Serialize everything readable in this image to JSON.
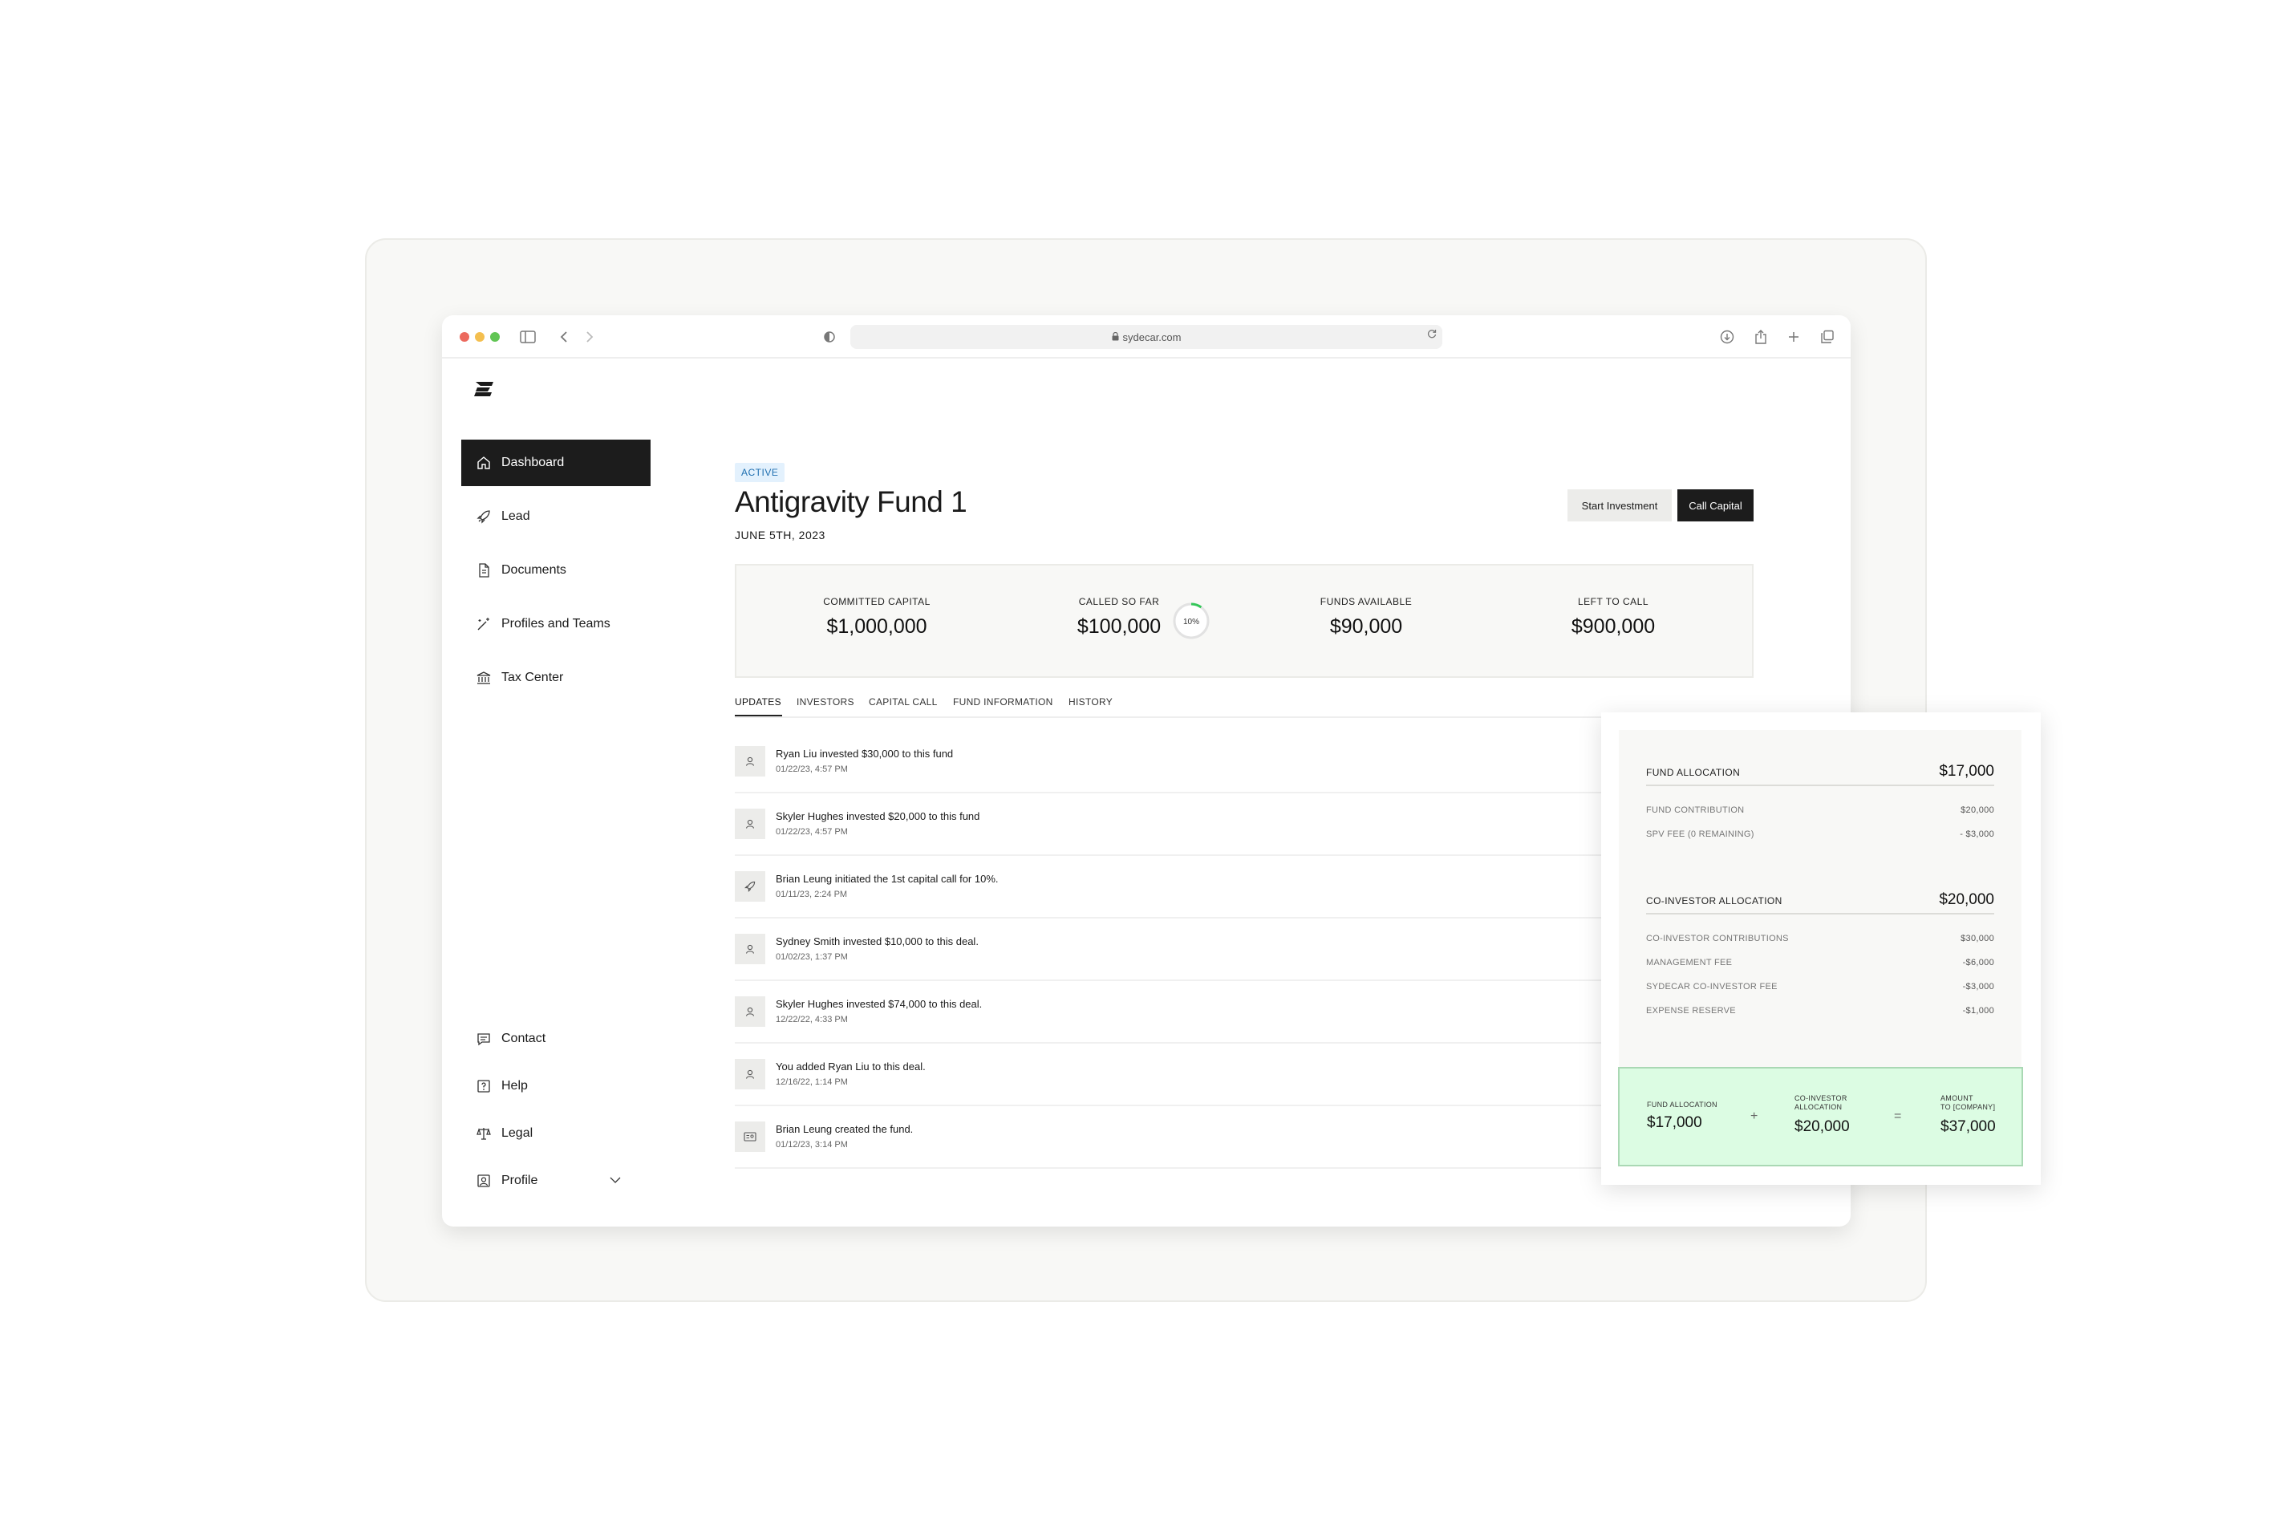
{
  "browser": {
    "url": "sydecar.com"
  },
  "nav": {
    "items": [
      {
        "label": "Dashboard"
      },
      {
        "label": "Lead"
      },
      {
        "label": "Documents"
      },
      {
        "label": "Profiles and Teams"
      },
      {
        "label": "Tax Center"
      }
    ],
    "bottom_items": [
      {
        "label": "Contact"
      },
      {
        "label": "Help"
      },
      {
        "label": "Legal"
      },
      {
        "label": "Profile"
      }
    ]
  },
  "fund": {
    "status": "ACTIVE",
    "name": "Antigravity Fund 1",
    "date": "JUNE 5TH, 2023"
  },
  "actions": {
    "start_investment": "Start Investment",
    "call_capital": "Call Capital"
  },
  "stats": [
    {
      "label": "COMMITTED CAPITAL",
      "value": "$1,000,000"
    },
    {
      "label": "CALLED SO FAR",
      "value": "$100,000",
      "progress_label": "10%",
      "progress": 0.1
    },
    {
      "label": "FUNDS AVAILABLE",
      "value": "$90,000"
    },
    {
      "label": "LEFT TO CALL",
      "value": "$900,000"
    }
  ],
  "tabs": [
    "UPDATES",
    "INVESTORS",
    "CAPITAL CALL",
    "FUND INFORMATION",
    "HISTORY"
  ],
  "updates": [
    {
      "text": "Ryan Liu invested $30,000 to this fund",
      "time": "01/22/23, 4:57 PM",
      "icon": "user-icon"
    },
    {
      "text": "Skyler Hughes invested $20,000 to this fund",
      "time": "01/22/23, 4:57 PM",
      "icon": "user-icon"
    },
    {
      "text": "Brian Leung initiated the 1st capital call for 10%.",
      "time": "01/11/23, 2:24 PM",
      "icon": "rocket-icon"
    },
    {
      "text": "Sydney Smith invested $10,000 to this deal.",
      "time": "01/02/23, 1:37 PM",
      "icon": "user-icon"
    },
    {
      "text": "Skyler Hughes invested $74,000 to this deal.",
      "time": "12/22/22, 4:33 PM",
      "icon": "user-icon"
    },
    {
      "text": "You added Ryan Liu to this deal.",
      "time": "12/16/22, 1:14 PM",
      "icon": "user-icon"
    },
    {
      "text": "Brian Leung created the fund.",
      "time": "01/12/23, 3:14 PM",
      "icon": "id-card-icon"
    }
  ],
  "allocation": {
    "fund_allocation": {
      "label": "FUND ALLOCATION",
      "value": "$17,000",
      "rows": [
        {
          "label": "FUND CONTRIBUTION",
          "value": "$20,000"
        },
        {
          "label": "SPV FEE (0 REMAINING)",
          "value": "- $3,000"
        }
      ]
    },
    "co_investor_allocation": {
      "label": "CO-INVESTOR ALLOCATION",
      "value": "$20,000",
      "rows": [
        {
          "label": "CO-INVESTOR CONTRIBUTIONS",
          "value": "$30,000"
        },
        {
          "label": "MANAGEMENT FEE",
          "value": "-$6,000"
        },
        {
          "label": "SYDECAR CO-INVESTOR FEE",
          "value": "-$3,000"
        },
        {
          "label": "EXPENSE RESERVE",
          "value": "-$1,000"
        }
      ]
    },
    "summary": {
      "fund_label": "FUND ALLOCATION",
      "fund_value": "$17,000",
      "plus": "+",
      "co_label_1": "CO-INVESTOR",
      "co_label_2": "ALLOCATION",
      "co_value": "$20,000",
      "equals": "=",
      "amount_label_1": "AMOUNT",
      "amount_label_2": "TO [COMPANY]",
      "amount_value": "$37,000"
    }
  },
  "colors": {
    "accent_dark": "#1c1c1c",
    "badge_bg": "#e3f1fd",
    "badge_text": "#1f6fb0",
    "summary_bg": "#dcfce3",
    "progress_ring": "#34c759"
  }
}
